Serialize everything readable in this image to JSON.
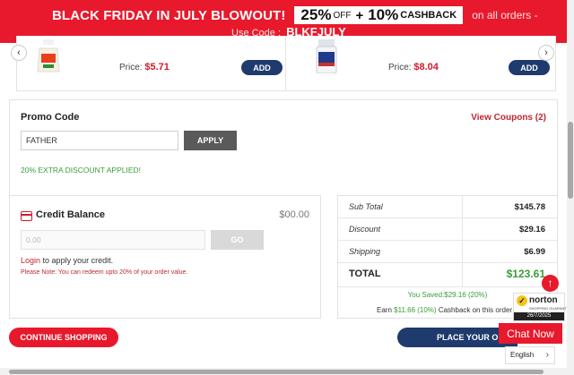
{
  "banner": {
    "headline": "BLACK FRIDAY IN JULY BLOWOUT!",
    "percent": "25%",
    "off": "OFF",
    "plus": "+",
    "cashback_percent": "10%",
    "cashback": "CASHBACK",
    "tail": "on all orders -",
    "use_code": "Use Code :",
    "code": "BLKFJULY"
  },
  "products": [
    {
      "price_label": "Price:",
      "price": "$5.71",
      "add": "ADD"
    },
    {
      "price_label": "Price:",
      "price": "$8.04",
      "add": "ADD"
    }
  ],
  "carousel": {
    "prev": "‹",
    "next": "›"
  },
  "promo": {
    "title": "Promo Code",
    "view_coupons": "View Coupons (2)",
    "code_value": "FATHER",
    "apply": "APPLY",
    "message": "20% EXTRA DISCOUNT APPLIED!"
  },
  "credit": {
    "title": "Credit Balance",
    "amount": "$00.00",
    "input_placeholder": "0.00",
    "go": "GO",
    "login": "Login",
    "login_rest": "to apply your credit.",
    "note": "Please Note: You can redeem upto 20% of your order value."
  },
  "summary": {
    "rows": [
      {
        "label": "Sub Total",
        "value": "$145.78"
      },
      {
        "label": "Discount",
        "value": "$29.16"
      },
      {
        "label": "Shipping",
        "value": "$6.99"
      },
      {
        "label": "TOTAL",
        "value": "$123.61"
      }
    ],
    "saved": "You Saved:$29.16 (20%)",
    "earn_prefix": "Earn",
    "earn_amount": "$11.66 (10%)",
    "earn_suffix": "Cashback on this order"
  },
  "buttons": {
    "continue": "CONTINUE SHOPPING",
    "place": "PLACE YOUR ORDER"
  },
  "widgets": {
    "scroll_top": "↑",
    "norton_check": "✓",
    "norton_name": "norton",
    "norton_sub": "SHOPPING GUARANTEE",
    "norton_date": "26/7/2025",
    "chat": "Chat Now",
    "language": "English",
    "language_chevron": "›"
  },
  "colors": {
    "brand_red": "#e8192c",
    "navy": "#1f3a6d",
    "green": "#3a9d3a"
  }
}
